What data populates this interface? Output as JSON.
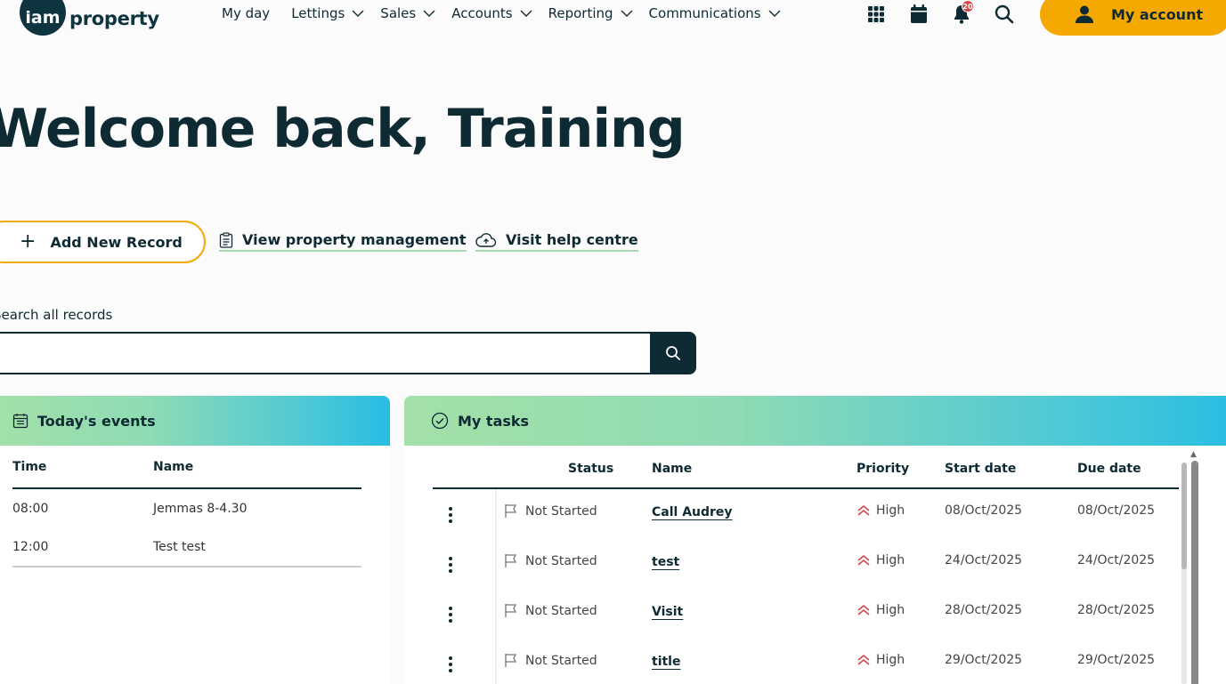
{
  "header": {
    "logo_iam": "iam",
    "logo_property": "property",
    "nav": [
      {
        "label": "My day",
        "has_dropdown": false
      },
      {
        "label": "Lettings",
        "has_dropdown": true
      },
      {
        "label": "Sales",
        "has_dropdown": true
      },
      {
        "label": "Accounts",
        "has_dropdown": true
      },
      {
        "label": "Reporting",
        "has_dropdown": true
      },
      {
        "label": "Communications",
        "has_dropdown": true
      }
    ],
    "notification_count": "20",
    "my_account_label": "My account"
  },
  "welcome": "Welcome back, Training",
  "actions": {
    "add_record": "Add New Record",
    "view_property": "View property management",
    "help_centre": "Visit help centre"
  },
  "search": {
    "label": "Search all records",
    "value": ""
  },
  "events": {
    "title": "Today's events",
    "columns": [
      "Time",
      "Name"
    ],
    "rows": [
      {
        "time": "08:00",
        "name": "Jemmas 8-4.30"
      },
      {
        "time": "12:00",
        "name": "Test test"
      }
    ]
  },
  "tasks": {
    "title": "My tasks",
    "columns": [
      "Status",
      "Name",
      "Priority",
      "Start date",
      "Due date"
    ],
    "rows": [
      {
        "status": "Not Started",
        "name": "Call Audrey",
        "priority": "High",
        "start": "08/Oct/2025",
        "due": "08/Oct/2025"
      },
      {
        "status": "Not Started",
        "name": "test",
        "priority": "High",
        "start": "24/Oct/2025",
        "due": "24/Oct/2025"
      },
      {
        "status": "Not Started",
        "name": "Visit",
        "priority": "High",
        "start": "28/Oct/2025",
        "due": "28/Oct/2025"
      },
      {
        "status": "Not Started",
        "name": "title",
        "priority": "High",
        "start": "29/Oct/2025",
        "due": "29/Oct/2025"
      }
    ]
  },
  "colors": {
    "accent": "#f5a800",
    "primary": "#0e2a33",
    "priority_high": "#d64545"
  }
}
